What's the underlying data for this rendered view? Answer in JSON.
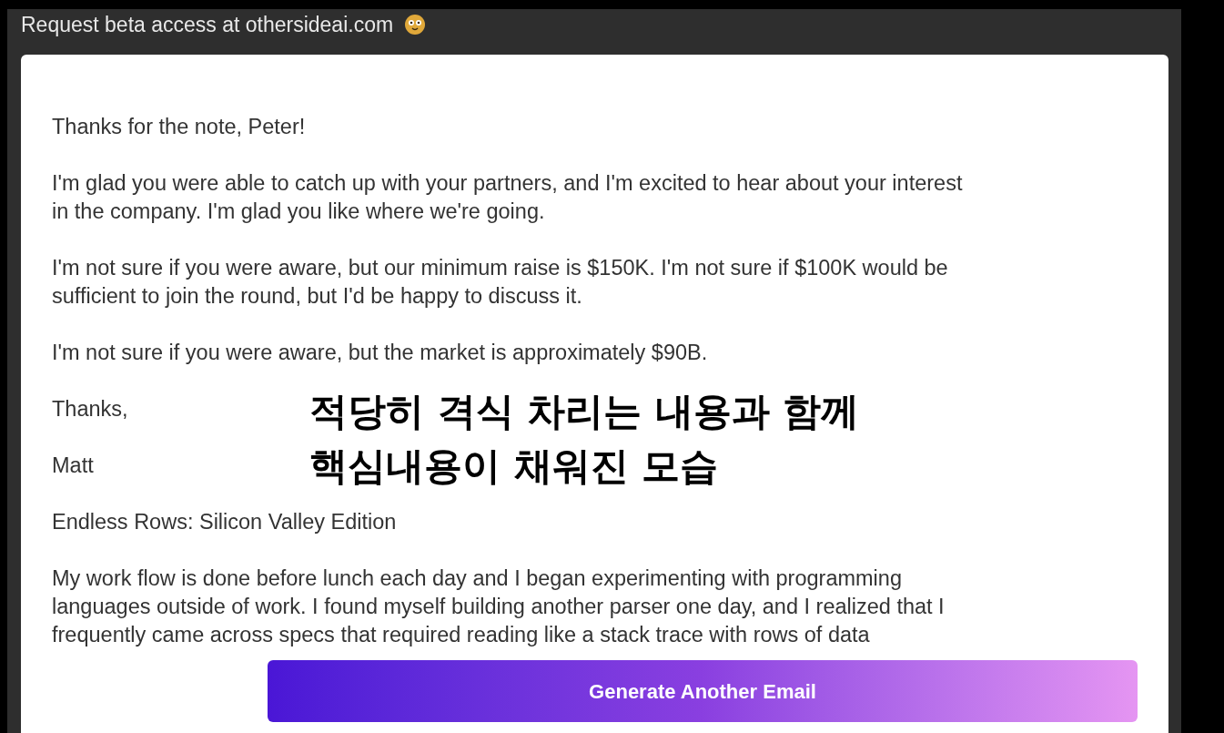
{
  "banner": {
    "text": "Request beta access at othersideai.com"
  },
  "email": {
    "paragraphs": [
      {
        "lines": [
          "Thanks for the note, Peter!"
        ]
      },
      {
        "lines": [
          "I'm glad you were able to catch up with your partners, and I'm excited to hear about your interest",
          "in the company. I'm glad you like where we're going."
        ]
      },
      {
        "lines": [
          "I'm not sure if you were aware, but our minimum raise is $150K. I'm not sure if $100K would be",
          "sufficient to join the round, but I'd be happy to discuss it."
        ]
      },
      {
        "lines": [
          "I'm not sure if you were aware, but the market is approximately $90B."
        ]
      },
      {
        "lines": [
          "Thanks,"
        ]
      },
      {
        "lines": [
          "Matt"
        ]
      },
      {
        "lines": [
          "Endless Rows: Silicon Valley Edition"
        ]
      },
      {
        "lines": [
          "My work flow is done before lunch each day and I began experimenting with programming",
          "languages outside of work. I found myself building another parser one day, and I realized that I",
          "frequently came across specs that required reading like a stack trace with rows of data"
        ]
      }
    ]
  },
  "button": {
    "label": "Generate Another Email"
  },
  "subtitle": {
    "lines": [
      "적당히 격식 차리는 내용과 함께",
      "핵심내용이 채워진 모습"
    ]
  }
}
